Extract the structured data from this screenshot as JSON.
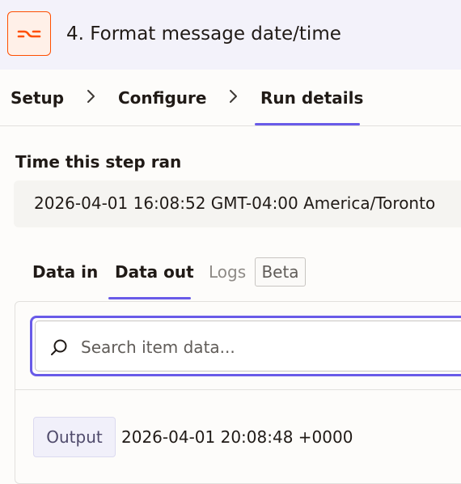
{
  "header": {
    "title": "4. Format message date/time",
    "icon": "formatter-icon",
    "accent": "#ff4f00"
  },
  "steps": [
    {
      "label": "Setup"
    },
    {
      "label": "Configure"
    },
    {
      "label": "Run details",
      "active": true
    }
  ],
  "time_ran": {
    "label": "Time this step ran",
    "value": "2026-04-01 16:08:52 GMT-04:00 America/Toronto"
  },
  "subtabs": {
    "data_in": "Data in",
    "data_out": "Data out",
    "logs": "Logs",
    "beta": "Beta",
    "active": "Data out"
  },
  "search": {
    "placeholder": "Search item data..."
  },
  "output": {
    "label": "Output",
    "value": "2026-04-01 20:08:48 +0000"
  },
  "colors": {
    "primary": "#695be8",
    "brand": "#ff4f00",
    "header_bg": "#f3f2fa"
  }
}
